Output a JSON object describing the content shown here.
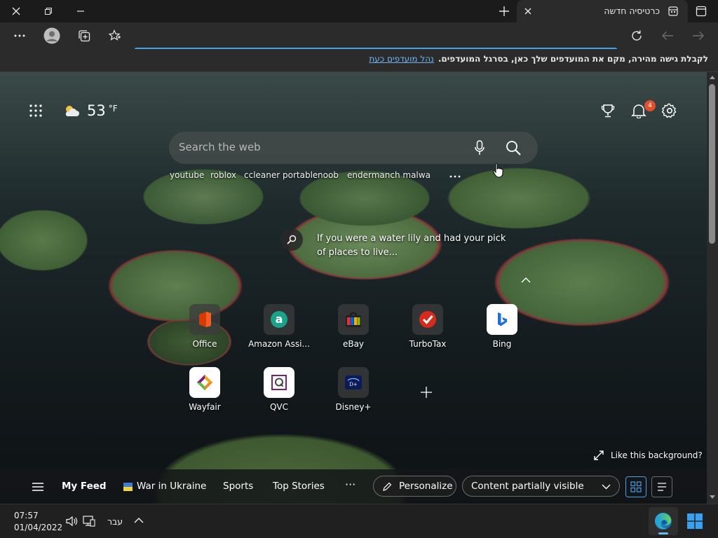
{
  "tab": {
    "title": "כרטיסיה חדשה"
  },
  "address": {
    "value": ""
  },
  "favorites_bar": {
    "message": "לקבלת גישה מהירה, מקם את המועדפים שלך כאן, בסרגל המועדפים.",
    "link": "נהל מועדפים כעת"
  },
  "weather": {
    "temp": "53",
    "unit": "°F"
  },
  "notifications": {
    "count": "4"
  },
  "search": {
    "placeholder": "Search the web",
    "quick_links": [
      "youtube",
      "roblox",
      "ccleaner portable",
      "noob",
      "endermanch malwar..."
    ]
  },
  "promo": {
    "text": "If you were a water lily and had your pick of places to live..."
  },
  "tiles": [
    {
      "label": "Office",
      "icon": "office-icon"
    },
    {
      "label": "Amazon Assi...",
      "icon": "amazon-icon"
    },
    {
      "label": "eBay",
      "icon": "ebay-icon"
    },
    {
      "label": "TurboTax",
      "icon": "turbotax-icon"
    },
    {
      "label": "Bing",
      "icon": "bing-icon"
    },
    {
      "label": "Wayfair",
      "icon": "wayfair-icon"
    },
    {
      "label": "QVC",
      "icon": "qvc-icon"
    },
    {
      "label": "Disney+",
      "icon": "disney-icon"
    }
  ],
  "background": {
    "prompt": "Like this background?"
  },
  "feed": {
    "my_feed": "My Feed",
    "tabs": [
      "War in Ukraine",
      "Sports",
      "Top Stories"
    ],
    "more": "···",
    "personalize": "Personalize",
    "visibility": "Content partially visible"
  },
  "taskbar": {
    "time": "07:57",
    "date": "01/04/2022",
    "language": "עבר"
  },
  "colors": {
    "accent": "#4aa0e6",
    "badge": "#e0502a"
  }
}
